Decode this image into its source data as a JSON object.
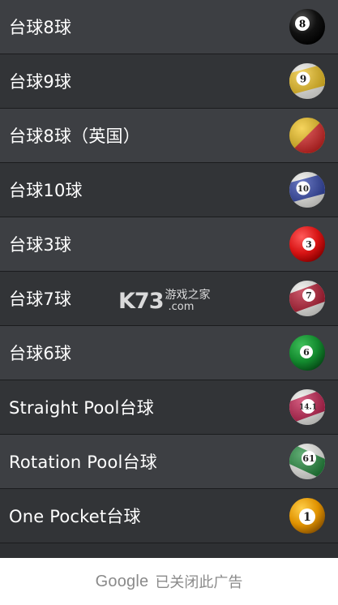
{
  "list": {
    "items": [
      {
        "label": "台球8球",
        "icon": "eight-ball-icon",
        "ball_number": "8"
      },
      {
        "label": "台球9球",
        "icon": "nine-ball-icon",
        "ball_number": "9"
      },
      {
        "label": "台球8球（英国）",
        "icon": "uk-eight-ball-icon"
      },
      {
        "label": "台球10球",
        "icon": "ten-ball-icon",
        "ball_number": "10"
      },
      {
        "label": "台球3球",
        "icon": "three-ball-icon",
        "ball_number": "3"
      },
      {
        "label": "台球7球",
        "icon": "seven-ball-icon",
        "ball_number": "7"
      },
      {
        "label": "台球6球",
        "icon": "six-ball-icon",
        "ball_number": "6"
      },
      {
        "label": "Straight Pool台球",
        "icon": "straight-pool-ball-icon",
        "ball_number": "14.1"
      },
      {
        "label": "Rotation Pool台球",
        "icon": "rotation-pool-ball-icon",
        "ball_number": "61"
      },
      {
        "label": "One Pocket台球",
        "icon": "one-pocket-ball-icon",
        "ball_number": "1"
      }
    ]
  },
  "watermark": {
    "mark": "K73",
    "text_cn": "游戏之家",
    "text_com": ".com"
  },
  "ad_bar": {
    "brand": "Google",
    "text": "已关闭此广告"
  },
  "colors": {
    "row_light": "#3d3f43",
    "row_dark": "#323437",
    "divider": "#1b1c1e",
    "ad_background": "#ffffff",
    "ad_text": "#8a8a8a"
  }
}
